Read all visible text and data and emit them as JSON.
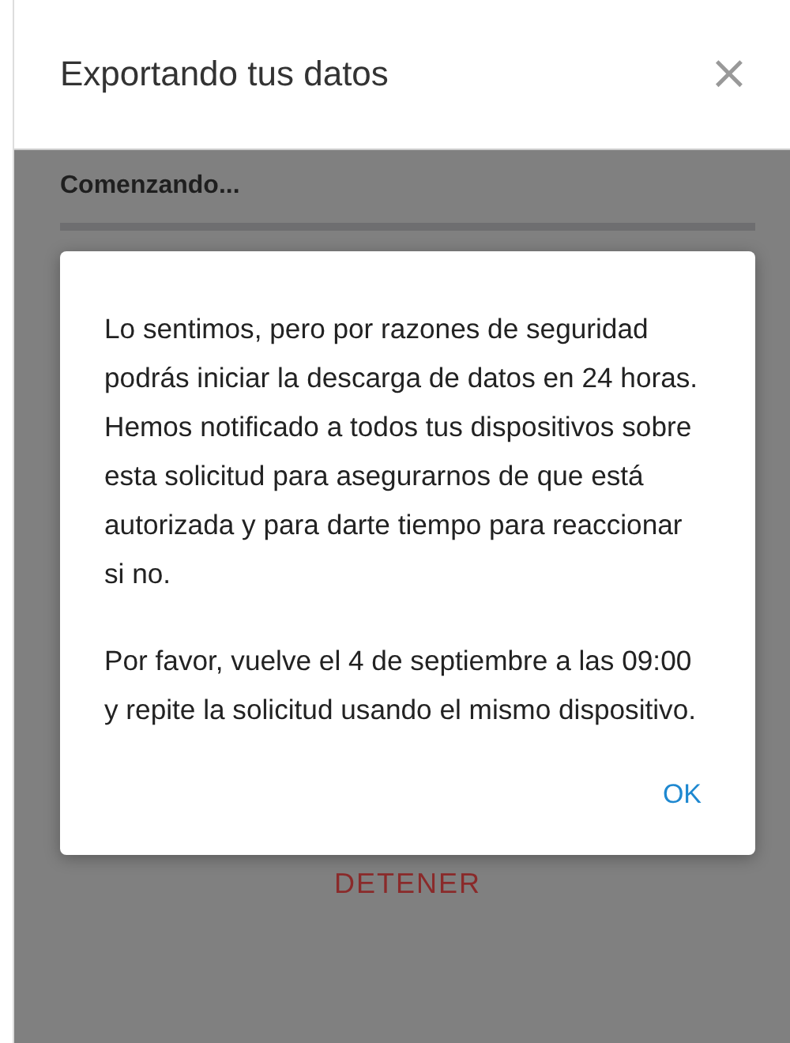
{
  "window": {
    "title": "Exportando tus datos",
    "close": "×"
  },
  "progress": {
    "label": "Comenzando..."
  },
  "stop_button": "DETENER",
  "dialog": {
    "paragraphs": [
      "Lo sentimos, pero por razones de seguridad podrás iniciar la descarga de datos en 24 horas. Hemos notificado a todos tus dispositivos sobre esta solicitud para asegurarnos de que está autorizada y para darte tiempo para reaccionar si no.",
      "Por favor, vuelve el 4 de septiembre a las 09:00 y repite la solicitud usando el mismo dispositivo."
    ],
    "button": "OK"
  }
}
